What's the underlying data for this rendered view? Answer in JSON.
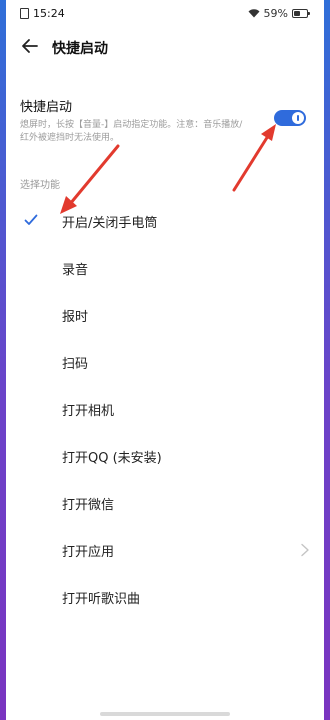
{
  "status_bar": {
    "time": "15:24",
    "battery": "59%"
  },
  "header": {
    "title": "快捷启动"
  },
  "quick_start": {
    "title": "快捷启动",
    "description": "熄屏时，长按【音量-】启动指定功能。注意：音乐播放/红外被遮挡时无法使用。",
    "toggle_on": true
  },
  "options_section": {
    "label": "选择功能",
    "items": [
      {
        "label": "开启/关闭手电筒",
        "selected": true
      },
      {
        "label": "录音"
      },
      {
        "label": "报时"
      },
      {
        "label": "扫码"
      },
      {
        "label": "打开相机"
      },
      {
        "label": "打开QQ (未安装)"
      },
      {
        "label": "打开微信"
      },
      {
        "label": "打开应用",
        "has_chevron": true
      },
      {
        "label": "打开听歌识曲"
      }
    ]
  },
  "colors": {
    "accent": "#2f6bdc",
    "annotation_arrow": "#e23a2e",
    "background_gradient_top": "#2f6fd8",
    "background_gradient_bottom": "#7a34c0"
  }
}
